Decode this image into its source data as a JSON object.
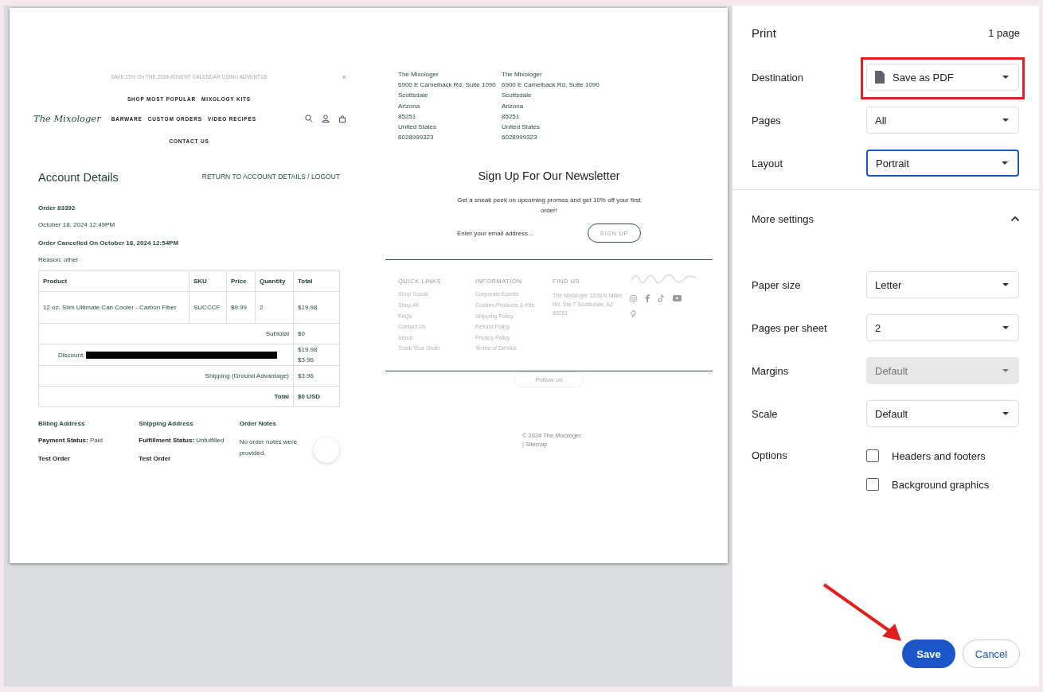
{
  "preview": {
    "announcement": {
      "text": "SAVE 15% On THE 2024 ADVENT CALENDAR USING ADVENT15!",
      "close": "×"
    },
    "logo": "The Mixologer",
    "nav_top": [
      "SHOP MOST POPULAR",
      "MIXOLOGY KITS"
    ],
    "nav_main": [
      "BARWARE",
      "CUSTOM ORDERS",
      "VIDEO RECIPES"
    ],
    "nav_bottom": [
      "CONTACT US"
    ],
    "heading": "Account Details",
    "return_link": "RETURN TO ACCOUNT DETAILS / LOGOUT",
    "order": "Order 83392",
    "date": "October 18, 2024 12:49PM",
    "cancelled": "Order Cancelled On October 18, 2024 12:54PM",
    "reason": "Reason: other",
    "table": {
      "columns": [
        "Product",
        "SKU",
        "Price",
        "Quantity",
        "Total"
      ],
      "rows": [
        [
          "12 oz. Slim Ultimate Can Cooler - Carbon Fiber",
          "SUCCCF",
          "$9.99",
          "2",
          "$19.98"
        ]
      ],
      "summary": [
        {
          "label": "Subtotal",
          "values": [
            "$0"
          ],
          "redacted": false,
          "bold": false
        },
        {
          "label": "Discount:",
          "values": [
            "$19.98",
            "$3.96"
          ],
          "redacted": true,
          "bold": false
        },
        {
          "label": "Shipping (Ground Advantage)",
          "values": [
            "$3.96"
          ],
          "redacted": false,
          "bold": false
        },
        {
          "label": "Total",
          "values": [
            "$0 USD"
          ],
          "redacted": false,
          "bold": true
        }
      ]
    },
    "info": [
      {
        "heading": "Billing Address",
        "status_label": "Payment Status:",
        "status_value": "Paid",
        "name": "Test Order"
      },
      {
        "heading": "Shipping Address",
        "status_label": "Fulfillment Status:",
        "status_value": "Unfulfilled",
        "name": "Test Order"
      },
      {
        "heading": "Order Notes",
        "note": "No order notes were provided."
      }
    ],
    "addresses": [
      [
        "The Mixologer",
        "6900 E Camelback Rd, Suite 1090",
        "Scottsdale",
        "Arizona",
        "85251",
        "United States",
        "6028999323"
      ],
      [
        "The Mixologer",
        "6900 E Camelback Rd, Suite 1090",
        "Scottsdale",
        "Arizona",
        "85251",
        "United States",
        "6028999323"
      ]
    ],
    "newsletter": {
      "title": "Sign Up For Our Newsletter",
      "text": "Get a sneak peek on upcoming promos and get 10% off your first order!",
      "placeholder": "Enter your email address...",
      "button": "SIGN UP"
    },
    "footer": [
      {
        "heading": "QUICK LINKS",
        "links": [
          "Shop Social",
          "Shop All",
          "FAQs",
          "Contact Us",
          "About",
          "Track Your Order"
        ]
      },
      {
        "heading": "INFORMATION",
        "links": [
          "Corporate Events",
          "Custom Products & Kits",
          "Shipping Policy",
          "Refund Policy",
          "Privacy Policy",
          "Terms of Service"
        ]
      },
      {
        "heading": "FIND US",
        "text": "The Mixologer 3226 N Miller Rd, Ste 7 Scottsdale, AZ 85251"
      }
    ],
    "follow": "Follow on",
    "copyright": [
      "© 2024 The Mixologer",
      "| Sitemap"
    ]
  },
  "panel": {
    "title": "Print",
    "pages_count": "1 page",
    "settings": [
      {
        "kind": "select",
        "label": "Destination",
        "value": "Save as PDF",
        "disabled": false,
        "focused": false
      },
      {
        "kind": "select",
        "label": "Pages",
        "value": "All",
        "disabled": false,
        "focused": false
      },
      {
        "kind": "select",
        "label": "Layout",
        "value": "Portrait",
        "disabled": false,
        "focused": true
      }
    ],
    "more": {
      "label": "More settings",
      "expanded": true
    },
    "more_settings": [
      {
        "kind": "select",
        "label": "Paper size",
        "value": "Letter",
        "disabled": false,
        "focused": false
      },
      {
        "kind": "select",
        "label": "Pages per sheet",
        "value": "2",
        "disabled": false,
        "focused": false
      },
      {
        "kind": "select",
        "label": "Margins",
        "value": "Default",
        "disabled": true,
        "focused": false
      },
      {
        "kind": "select",
        "label": "Scale",
        "value": "Default",
        "disabled": false,
        "focused": false
      },
      {
        "kind": "checkboxes",
        "label": "Options",
        "options": [
          {
            "label": "Headers and footers",
            "checked": false
          },
          {
            "label": "Background graphics",
            "checked": false
          }
        ]
      }
    ],
    "buttons": [
      {
        "label": "Save",
        "kind": "primary"
      },
      {
        "label": "Cancel",
        "kind": "secondary"
      }
    ]
  },
  "annotations": {
    "highlight_frame": true,
    "arrow": true
  }
}
